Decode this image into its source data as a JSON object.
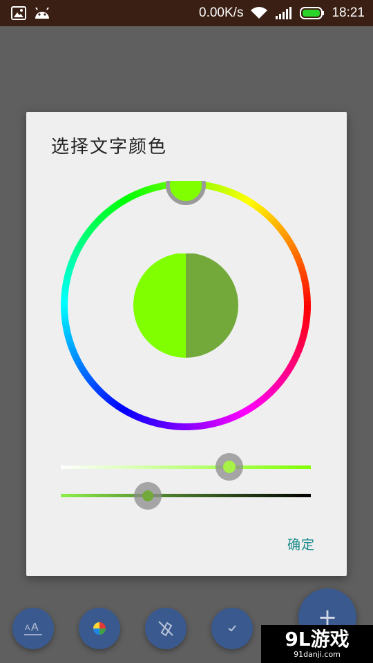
{
  "status_bar": {
    "network_speed": "0.00K/s",
    "time": "18:21",
    "icons": [
      "image-icon",
      "android-icon",
      "wifi-icon",
      "signal-icon",
      "battery-icon"
    ]
  },
  "dialog": {
    "title": "选择文字颜色",
    "confirm_label": "确定",
    "color_wheel": {
      "selected_color": "#7fff00",
      "old_color": "#7fff00",
      "new_color": "#72a93a"
    },
    "saturation_slider": {
      "value": 0.68,
      "start_color": "#ffffff",
      "end_color": "#7fff00"
    },
    "value_slider": {
      "value": 0.35,
      "start_color": "#7fff00",
      "end_color": "#000000"
    }
  },
  "toolbar": {
    "buttons": [
      "text-size-icon",
      "color-palette-icon",
      "no-highlight-icon",
      "check-icon"
    ],
    "add_label": "+"
  },
  "watermark": {
    "main": "9L游戏",
    "sub": "91danji.com"
  },
  "colors": {
    "accent": "#1a8a8a",
    "fab": "#3a5a8f",
    "status_bar": "#3a1f14"
  }
}
